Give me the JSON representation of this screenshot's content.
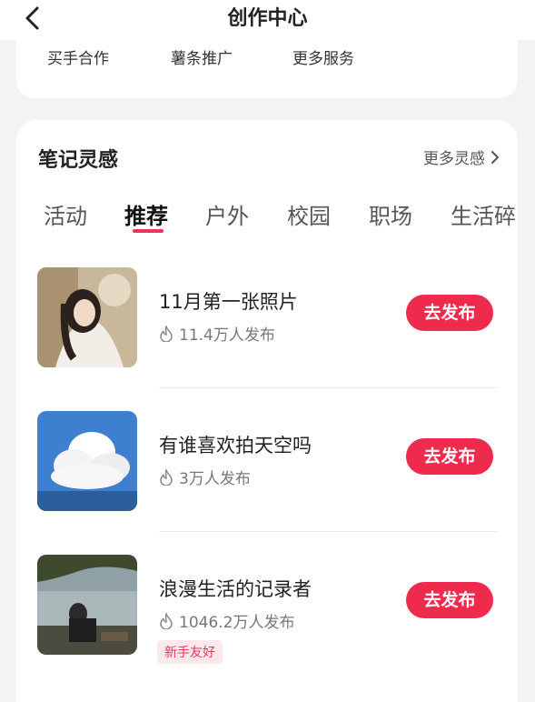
{
  "header": {
    "title": "创作中心",
    "back_icon": "chevron-left-icon"
  },
  "services": [
    "买手合作",
    "薯条推广",
    "更多服务"
  ],
  "inspiration": {
    "title": "笔记灵感",
    "more_label": "更多灵感",
    "tabs": [
      "活动",
      "推荐",
      "户外",
      "校园",
      "职场",
      "生活碎"
    ],
    "active_tab": 1,
    "items": [
      {
        "title": "11月第一张照片",
        "count": "11.4万人发布",
        "button": "去发布",
        "badge": ""
      },
      {
        "title": "有谁喜欢拍天空吗",
        "count": "3万人发布",
        "button": "去发布",
        "badge": ""
      },
      {
        "title": "浪漫生活的记录者",
        "count": "1046.2万人发布",
        "button": "去发布",
        "badge": "新手友好"
      }
    ]
  },
  "colors": {
    "accent": "#ee2a4d",
    "background": "#f3f3f3",
    "card": "#ffffff"
  }
}
